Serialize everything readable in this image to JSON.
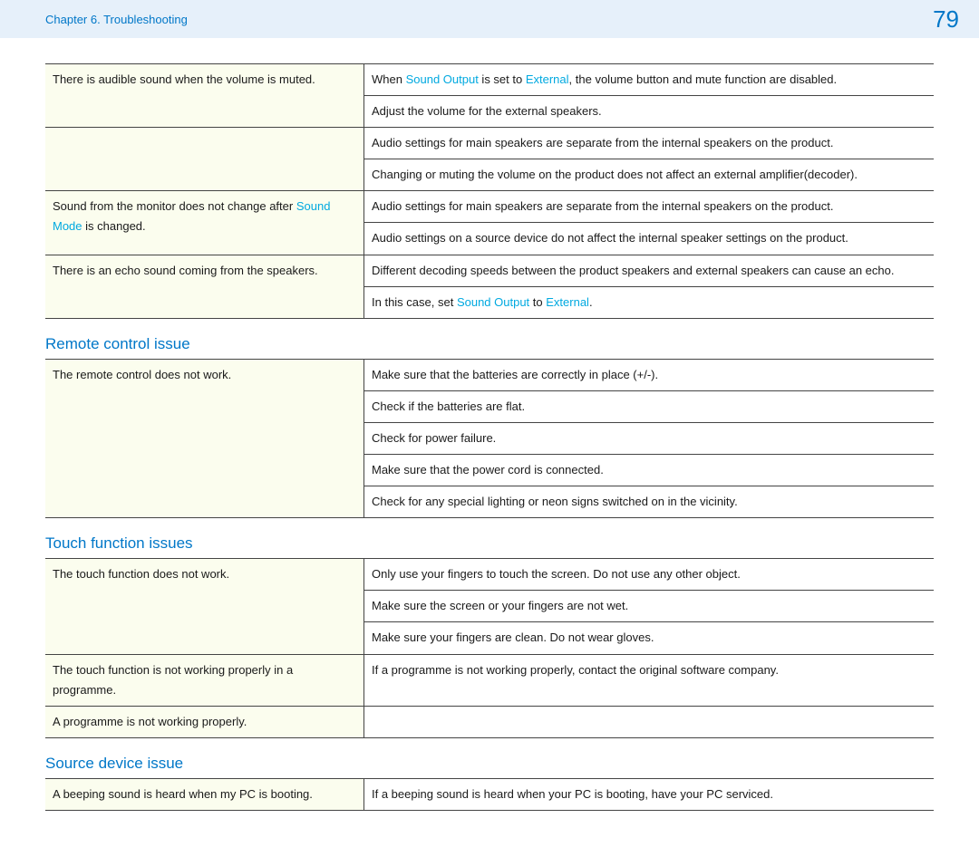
{
  "header": {
    "chapter": "Chapter 6. Troubleshooting",
    "page": "79"
  },
  "links": {
    "sound_output": "Sound Output",
    "external": "External",
    "sound_mode": "Sound Mode"
  },
  "table1": [
    {
      "problem": "There is audible sound when the volume is muted.",
      "solutions": [
        {
          "parts": [
            {
              "t": "When "
            },
            {
              "link": "sound_output"
            },
            {
              "t": " is set to "
            },
            {
              "link": "external"
            },
            {
              "t": ", the volume button and mute function are disabled."
            }
          ]
        },
        {
          "parts": [
            {
              "t": "Adjust the volume for the external speakers."
            }
          ]
        }
      ]
    },
    {
      "problem": "",
      "solutions": [
        {
          "parts": [
            {
              "t": "Audio settings for main speakers are separate from the internal speakers on the product."
            }
          ]
        },
        {
          "parts": [
            {
              "t": "Changing or muting the volume on the product does not affect an external amplifier(decoder)."
            }
          ]
        }
      ]
    },
    {
      "problem_parts": [
        {
          "t": "Sound from the monitor does not change after "
        },
        {
          "link": "sound_mode"
        },
        {
          "t": " is changed."
        }
      ],
      "solutions": [
        {
          "parts": [
            {
              "t": "Audio settings for main speakers are separate from the internal speakers on the product."
            }
          ]
        },
        {
          "parts": [
            {
              "t": "Audio settings on a source device do not affect the internal speaker settings on the product."
            }
          ]
        }
      ]
    },
    {
      "problem": "There is an echo sound coming from the speakers.",
      "solutions": [
        {
          "parts": [
            {
              "t": "Different decoding speeds between the product speakers and external speakers can cause an echo."
            }
          ]
        },
        {
          "parts": [
            {
              "t": "In this case, set "
            },
            {
              "link": "sound_output"
            },
            {
              "t": " to "
            },
            {
              "link": "external"
            },
            {
              "t": "."
            }
          ]
        }
      ]
    }
  ],
  "section_remote": "Remote control issue",
  "table2": [
    {
      "problem": "The remote control does not work.",
      "solutions": [
        {
          "parts": [
            {
              "t": "Make sure that the batteries are correctly in place (+/-)."
            }
          ]
        },
        {
          "parts": [
            {
              "t": "Check if the batteries are flat."
            }
          ]
        },
        {
          "parts": [
            {
              "t": "Check for power failure."
            }
          ]
        },
        {
          "parts": [
            {
              "t": "Make sure that the power cord is connected."
            }
          ]
        },
        {
          "parts": [
            {
              "t": "Check for any special lighting or neon signs switched on in the vicinity."
            }
          ]
        }
      ]
    }
  ],
  "section_touch": "Touch function issues",
  "table3": [
    {
      "problem": "The touch function does not work.",
      "solutions": [
        {
          "parts": [
            {
              "t": "Only use your fingers to touch the screen. Do not use any other object."
            }
          ]
        },
        {
          "parts": [
            {
              "t": "Make sure the screen or your fingers are not wet."
            }
          ]
        },
        {
          "parts": [
            {
              "t": "Make sure your fingers are clean. Do not wear gloves."
            }
          ]
        }
      ]
    },
    {
      "problem": "The touch function is not working properly in a programme.",
      "solutions": [
        {
          "parts": [
            {
              "t": "If a programme is not working properly, contact the original software company."
            }
          ]
        }
      ]
    },
    {
      "problem": "A programme is not working properly.",
      "solutions": [
        {
          "parts": [
            {
              "t": ""
            }
          ]
        }
      ]
    }
  ],
  "section_source": "Source device issue",
  "table4": [
    {
      "problem": "A beeping sound is heard when my PC is booting.",
      "solutions": [
        {
          "parts": [
            {
              "t": "If a beeping sound is heard when your PC is booting, have your PC serviced."
            }
          ]
        }
      ]
    }
  ]
}
